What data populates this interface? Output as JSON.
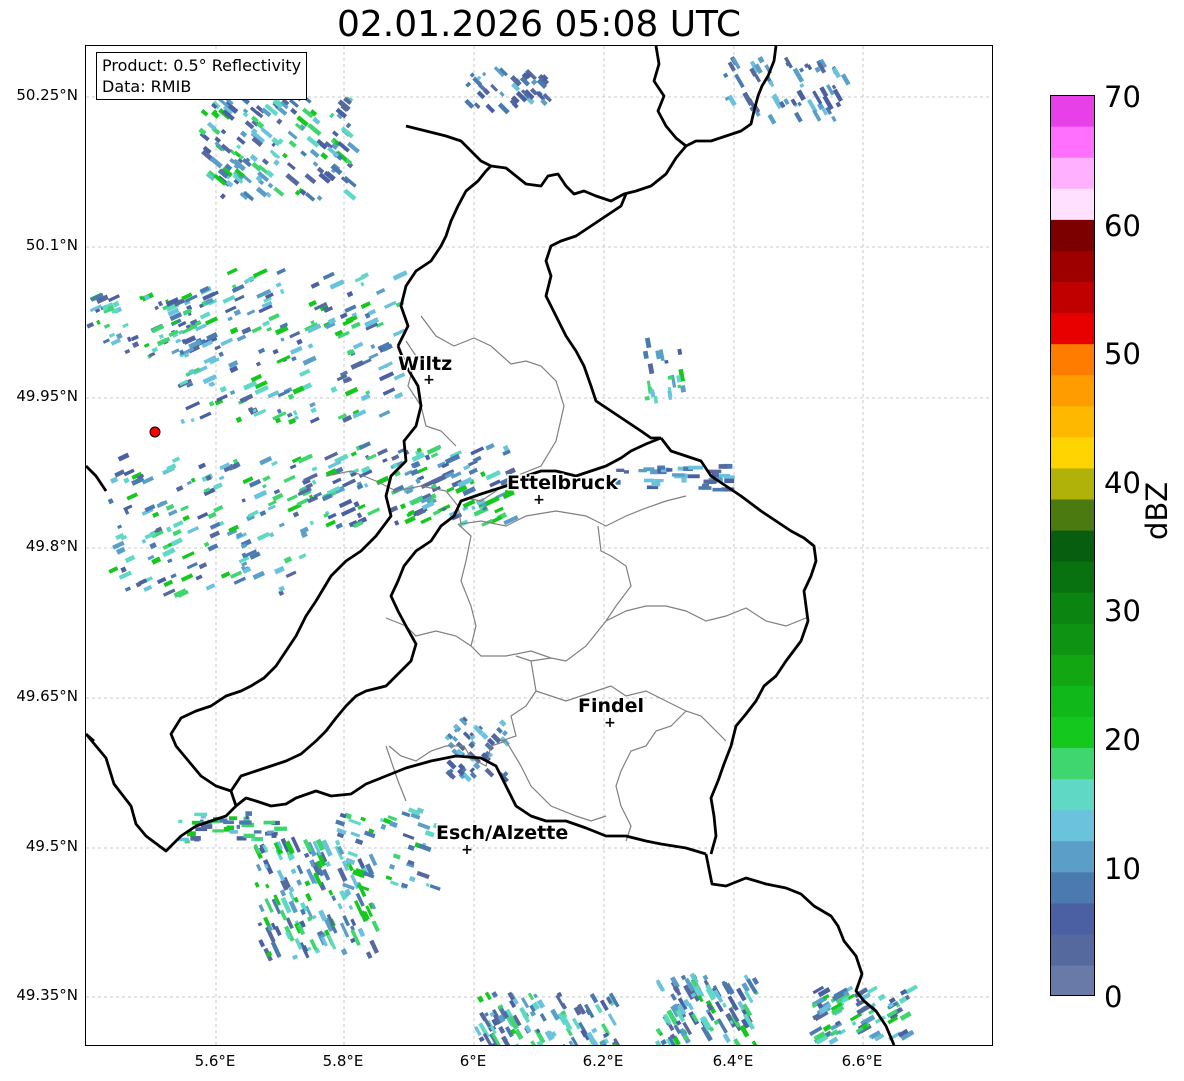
{
  "title": "02.01.2026 05:08 UTC",
  "info": {
    "product": "Product: 0.5° Reflectivity",
    "data": "Data: RMIB"
  },
  "axes": {
    "lat_ticks": [
      "50.25°N",
      "50.1°N",
      "49.95°N",
      "49.8°N",
      "49.65°N",
      "49.5°N",
      "49.35°N"
    ],
    "lon_ticks": [
      "5.6°E",
      "5.8°E",
      "6°E",
      "6.2°E",
      "6.4°E",
      "6.6°E"
    ]
  },
  "cities": [
    {
      "name": "Wiltz",
      "marker": "+"
    },
    {
      "name": "Ettelbruck",
      "marker": "+"
    },
    {
      "name": "Findel",
      "marker": "+"
    },
    {
      "name": "Esch/Alzette",
      "marker": "+"
    }
  ],
  "radar_site": {
    "color": "#ff0000"
  },
  "colorbar": {
    "label": "dBZ",
    "ticks": [
      "70",
      "60",
      "50",
      "40",
      "30",
      "20",
      "10",
      "0"
    ],
    "colors": [
      "#6a7aa8",
      "#55699f",
      "#4a60a2",
      "#4a7ab0",
      "#5b9ec8",
      "#6ac2dd",
      "#5fd8c5",
      "#3fd670",
      "#14c81e",
      "#10b81a",
      "#12a612",
      "#0e9412",
      "#0c8412",
      "#097210",
      "#075e0e",
      "#4a7a10",
      "#b0b20a",
      "#ffd400",
      "#ffb800",
      "#ff9c00",
      "#ff7c00",
      "#e80000",
      "#c00000",
      "#9e0000",
      "#7c0000",
      "#ffe0ff",
      "#ffb0ff",
      "#ff70ff",
      "#e840e8"
    ]
  }
}
